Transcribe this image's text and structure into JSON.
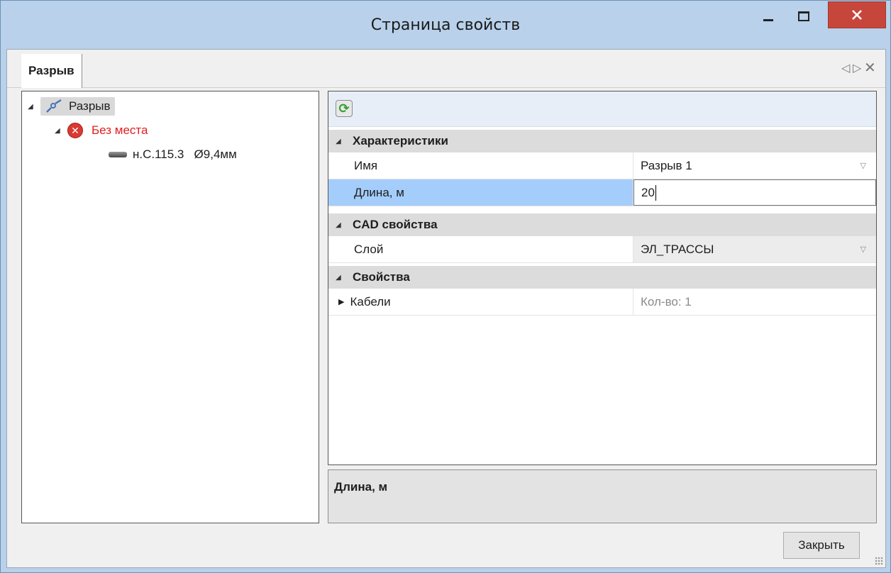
{
  "window": {
    "title": "Страница свойств",
    "close_glyph": "✕"
  },
  "tab": {
    "label": "Разрыв",
    "controls": {
      "left": "◁",
      "right": "▷",
      "close": "✕"
    }
  },
  "tree": {
    "root": {
      "label": "Разрыв",
      "icon": "break-icon"
    },
    "child": {
      "label": "Без места",
      "icon": "error-icon"
    },
    "leaf": {
      "label": "н.С.115.3   Ø9,4мм",
      "icon": "cable-icon"
    }
  },
  "toolbar": {
    "refresh_icon": "refresh-icon"
  },
  "categories": {
    "characteristics": "Характеристики",
    "cad": "CAD свойства",
    "properties": "Свойства"
  },
  "rows": {
    "name": {
      "label": "Имя",
      "value": "Разрыв 1"
    },
    "length": {
      "label": "Длина, м",
      "value": "20"
    },
    "layer": {
      "label": "Слой",
      "value": "ЭЛ_ТРАССЫ"
    },
    "cables": {
      "label": "Кабели",
      "value": "Кол-во: 1"
    }
  },
  "description": {
    "title": "Длина, м"
  },
  "buttons": {
    "close": "Закрыть"
  },
  "colors": {
    "titlebar": "#b9d1ea",
    "close_button": "#c7463c",
    "error": "#e21e1e",
    "selection": "#a4cdfb"
  }
}
